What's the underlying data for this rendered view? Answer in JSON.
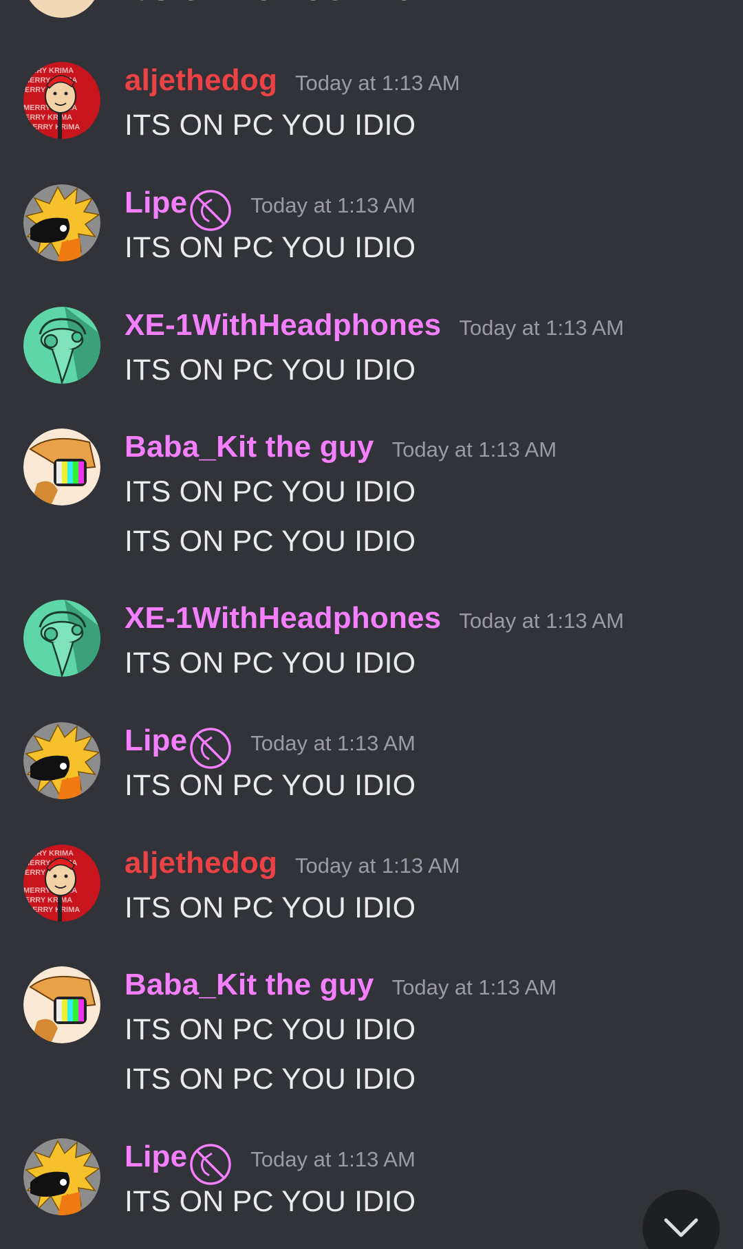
{
  "colors": {
    "background": "#313338",
    "message_text": "#eaebee",
    "timestamp": "#9b9ca3",
    "username_pink": "#f47fff",
    "username_red": "#ed4245"
  },
  "top_partial": {
    "text": "ITS ON PC YOU IDIO"
  },
  "messages": [
    {
      "user": "aljethedog",
      "color": "#ed4245",
      "avatar": "dog-santa-avatar",
      "status_icon": false,
      "timestamp": "Today at 1:13 AM",
      "lines": [
        "ITS ON PC YOU IDIO"
      ]
    },
    {
      "user": "Lipe",
      "color": "#f47fff",
      "avatar": "yellow-creature-avatar",
      "status_icon": true,
      "timestamp": "Today at 1:13 AM",
      "lines": [
        "ITS ON PC YOU IDIO"
      ]
    },
    {
      "user": "XE-1WithHeadphones",
      "color": "#f47fff",
      "avatar": "green-headphones-avatar",
      "status_icon": false,
      "timestamp": "Today at 1:13 AM",
      "lines": [
        "ITS ON PC YOU IDIO"
      ]
    },
    {
      "user": "Baba_Kit the guy",
      "color": "#f47fff",
      "avatar": "tv-head-avatar",
      "status_icon": false,
      "timestamp": "Today at 1:13 AM",
      "lines": [
        "ITS ON PC YOU IDIO",
        "ITS ON PC YOU IDIO"
      ]
    },
    {
      "user": "XE-1WithHeadphones",
      "color": "#f47fff",
      "avatar": "green-headphones-avatar",
      "status_icon": false,
      "timestamp": "Today at 1:13 AM",
      "lines": [
        "ITS ON PC YOU IDIO"
      ]
    },
    {
      "user": "Lipe",
      "color": "#f47fff",
      "avatar": "yellow-creature-avatar",
      "status_icon": true,
      "timestamp": "Today at 1:13 AM",
      "lines": [
        "ITS ON PC YOU IDIO"
      ]
    },
    {
      "user": "aljethedog",
      "color": "#ed4245",
      "avatar": "dog-santa-avatar",
      "status_icon": false,
      "timestamp": "Today at 1:13 AM",
      "lines": [
        "ITS ON PC YOU IDIO"
      ]
    },
    {
      "user": "Baba_Kit the guy",
      "color": "#f47fff",
      "avatar": "tv-head-avatar",
      "status_icon": false,
      "timestamp": "Today at 1:13 AM",
      "lines": [
        "ITS ON PC YOU IDIO",
        "ITS ON PC YOU IDIO"
      ]
    },
    {
      "user": "Lipe",
      "color": "#f47fff",
      "avatar": "yellow-creature-avatar",
      "status_icon": true,
      "timestamp": "Today at 1:13 AM",
      "lines": [
        "ITS ON PC YOU IDIO"
      ]
    }
  ],
  "scroll_button": {
    "icon": "chevron-down-icon"
  }
}
